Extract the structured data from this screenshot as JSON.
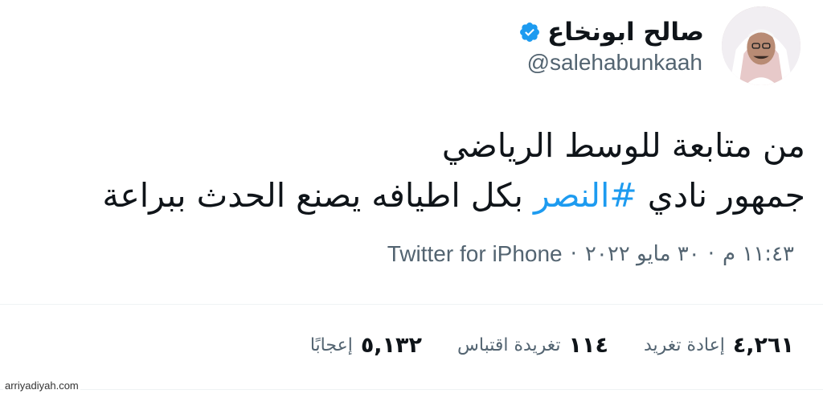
{
  "tweet": {
    "display_name": "صالح ابونخاع",
    "handle": "@salehabunkaah",
    "verified_icon": "verified-badge-icon",
    "text_line_1": "من متابعة للوسط الرياضي",
    "text_line_2_before": "جمهور نادي ",
    "hashtag": "#النصر",
    "text_line_2_after": " بكل اطيافه يصنع الحدث ببراعة",
    "time": "١١:٤٣ م",
    "date": "٣٠ مايو ٢٠٢٢",
    "separator": "·",
    "source": "Twitter for iPhone"
  },
  "stats": {
    "retweets_count": "٤,٢٦١",
    "retweets_label": "إعادة تغريد",
    "quotes_count": "١١٤",
    "quotes_label": "تغريدة اقتباس",
    "likes_count": "٥,١٣٢",
    "likes_label": "إعجابًا"
  },
  "watermark": "arriyadiyah.com",
  "colors": {
    "accent": "#1d9bf0",
    "text": "#0f1419",
    "muted": "#536471"
  }
}
